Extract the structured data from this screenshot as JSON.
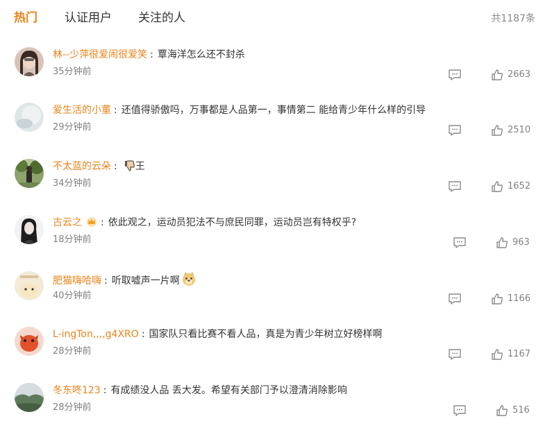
{
  "tabs": [
    {
      "label": "热门",
      "active": true
    },
    {
      "label": "认证用户",
      "active": false
    },
    {
      "label": "关注的人",
      "active": false
    }
  ],
  "total_count": "共1187条",
  "accent_color": "#e8831a",
  "comments": [
    {
      "user": "林--少萍很爱闹很爱笑",
      "text": "覃海洋怎么还不封杀",
      "time": "35分钟前",
      "likes": "2663"
    },
    {
      "user": "爱生活的小董",
      "text": "还值得骄傲吗，万事都是人品第一，事情第二 能给青少年什么样的引导",
      "time": "29分钟前",
      "likes": "2510"
    },
    {
      "user": "不太蓝的云朵",
      "text": "王",
      "emoji": "thumbs-down-emoji",
      "time": "34分钟前",
      "likes": "1652"
    },
    {
      "user": "古云之",
      "text": "依此观之，运动员犯法不与庶民同罪，运动员岂有特权乎?",
      "badge": "crown-badge-icon",
      "time": "18分钟前",
      "likes": "963"
    },
    {
      "user": "肥猫嗨哈嗨",
      "text": "听取嘘声一片啊",
      "emoji": "doge-emoji",
      "time": "40分钟前",
      "likes": "1166"
    },
    {
      "user": "L-ingTon,,,,g4XRO",
      "text": "国家队只看比赛不看人品，真是为青少年树立好榜样啊",
      "time": "28分钟前",
      "likes": "1167"
    },
    {
      "user": "冬东咚123",
      "text": "有成绩没人品 丢大发。希望有关部门予以澄清消除影响",
      "time": "28分钟前",
      "likes": "516"
    }
  ]
}
